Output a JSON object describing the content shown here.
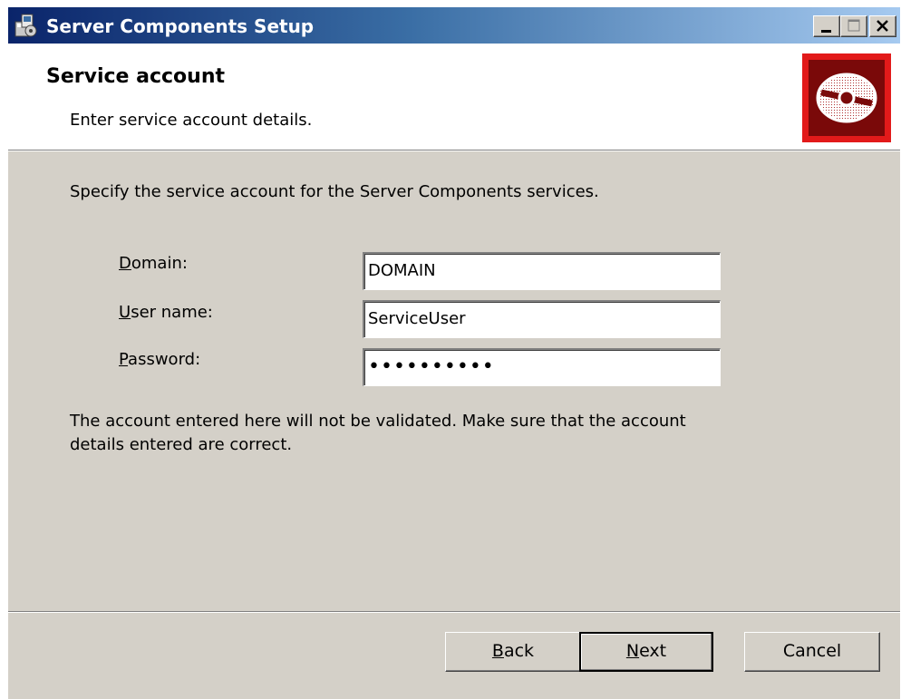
{
  "window": {
    "title": "Server Components Setup",
    "icon": "setup-app-icon",
    "controls": [
      "minimize",
      "maximize",
      "close"
    ]
  },
  "header": {
    "title": "Service account",
    "subtitle": "Enter service account details.",
    "banner_icon": "disc-icon",
    "banner_color": "#e21a1a"
  },
  "content": {
    "intro": "Specify the service account for the Server Components services.",
    "fields": [
      {
        "label_mnemonic": "D",
        "label_rest": "omain:",
        "value": "DOMAIN"
      },
      {
        "label_mnemonic": "U",
        "label_rest": "ser name:",
        "value": "ServiceUser"
      },
      {
        "label_mnemonic": "P",
        "label_rest": "assword:",
        "value": "••••••••••"
      }
    ],
    "note": "The account entered here will not be validated. Make sure that the account details entered are correct."
  },
  "buttons": {
    "back": {
      "mnemonic": "B",
      "rest": "ack"
    },
    "next": {
      "mnemonic": "N",
      "rest": "ext"
    },
    "cancel": "Cancel"
  }
}
